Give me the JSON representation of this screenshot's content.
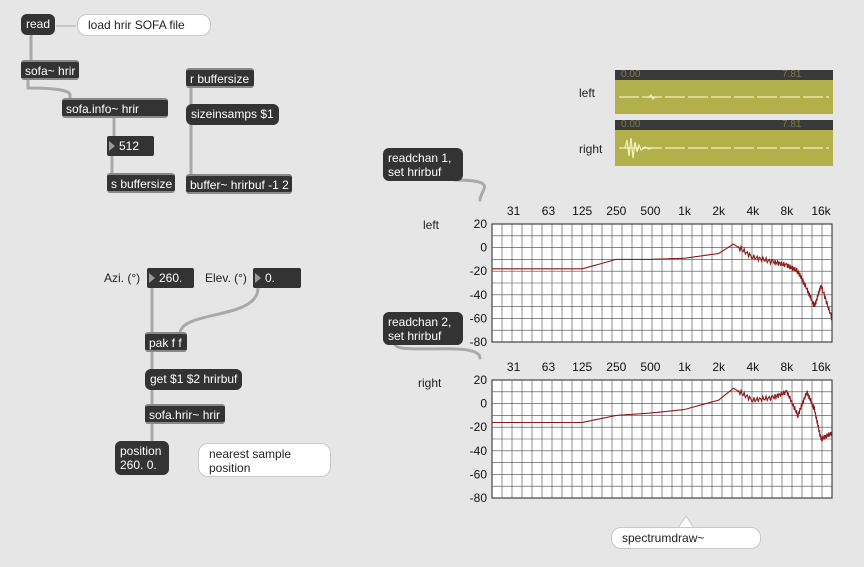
{
  "patch": {
    "read_msg": "read",
    "read_comment": "load hrir SOFA file",
    "sofa_hrir": "sofa~ hrir",
    "sofa_info": "sofa.info~ hrir",
    "num_512": "512",
    "s_buffersize": "s buffersize",
    "r_buffersize": "r buffersize",
    "sizeinsamps_msg": "sizeinsamps $1",
    "buffer_obj": "buffer~ hrirbuf -1 2",
    "azi_label": "Azi. (°)",
    "azi_value": "260.",
    "elev_label": "Elev. (°)",
    "elev_value": "0.",
    "pak": "pak f f",
    "get_msg": "get $1 $2 hrirbuf",
    "sofa_hrir_obj": "sofa.hrir~ hrir",
    "position_line1": "position",
    "position_line2": "260. 0.",
    "position_comment_line1": "nearest sample",
    "position_comment_line2": "position",
    "readchan1_line1": "readchan 1,",
    "readchan1_line2": "set hrirbuf",
    "readchan2_line1": "readchan 2,",
    "readchan2_line2": "set hrirbuf",
    "spectrum_comment": "spectrumdraw~"
  },
  "waveforms": {
    "left_label": "left",
    "right_label": "right",
    "start_time": "0.00",
    "end_time": "7.81",
    "color": "#b2b04a"
  },
  "spectra": {
    "left_label": "left",
    "right_label": "right",
    "freq_ticks": [
      "31",
      "63",
      "125",
      "250",
      "500",
      "1k",
      "2k",
      "4k",
      "8k",
      "16k"
    ],
    "db_ticks": [
      "20",
      "0",
      "-20",
      "-40",
      "-60",
      "-80"
    ],
    "line_color": "#8b1a1a"
  },
  "chart_data": [
    {
      "type": "line",
      "series": [
        {
          "name": "left",
          "x": [
            20,
            125,
            250,
            500,
            1000,
            2000,
            2700,
            4000,
            6000,
            8000,
            10000,
            12000,
            14000,
            16000,
            20000
          ],
          "values": [
            -18,
            -18,
            -10,
            -10,
            -9,
            -5,
            3,
            -8,
            -12,
            -15,
            -20,
            -35,
            -50,
            -32,
            -60
          ]
        }
      ],
      "title": "left",
      "ylim": [
        -80,
        20
      ],
      "xscale": "log",
      "grid": true
    },
    {
      "type": "line",
      "series": [
        {
          "name": "right",
          "x": [
            20,
            125,
            250,
            500,
            1000,
            2000,
            2700,
            4000,
            6000,
            8000,
            10000,
            12000,
            14000,
            16000,
            20000
          ],
          "values": [
            -16,
            -16,
            -10,
            -8,
            -5,
            3,
            13,
            3,
            5,
            10,
            -10,
            10,
            -5,
            -30,
            -25
          ]
        }
      ],
      "title": "right",
      "ylim": [
        -80,
        20
      ],
      "xscale": "log",
      "grid": true
    }
  ]
}
